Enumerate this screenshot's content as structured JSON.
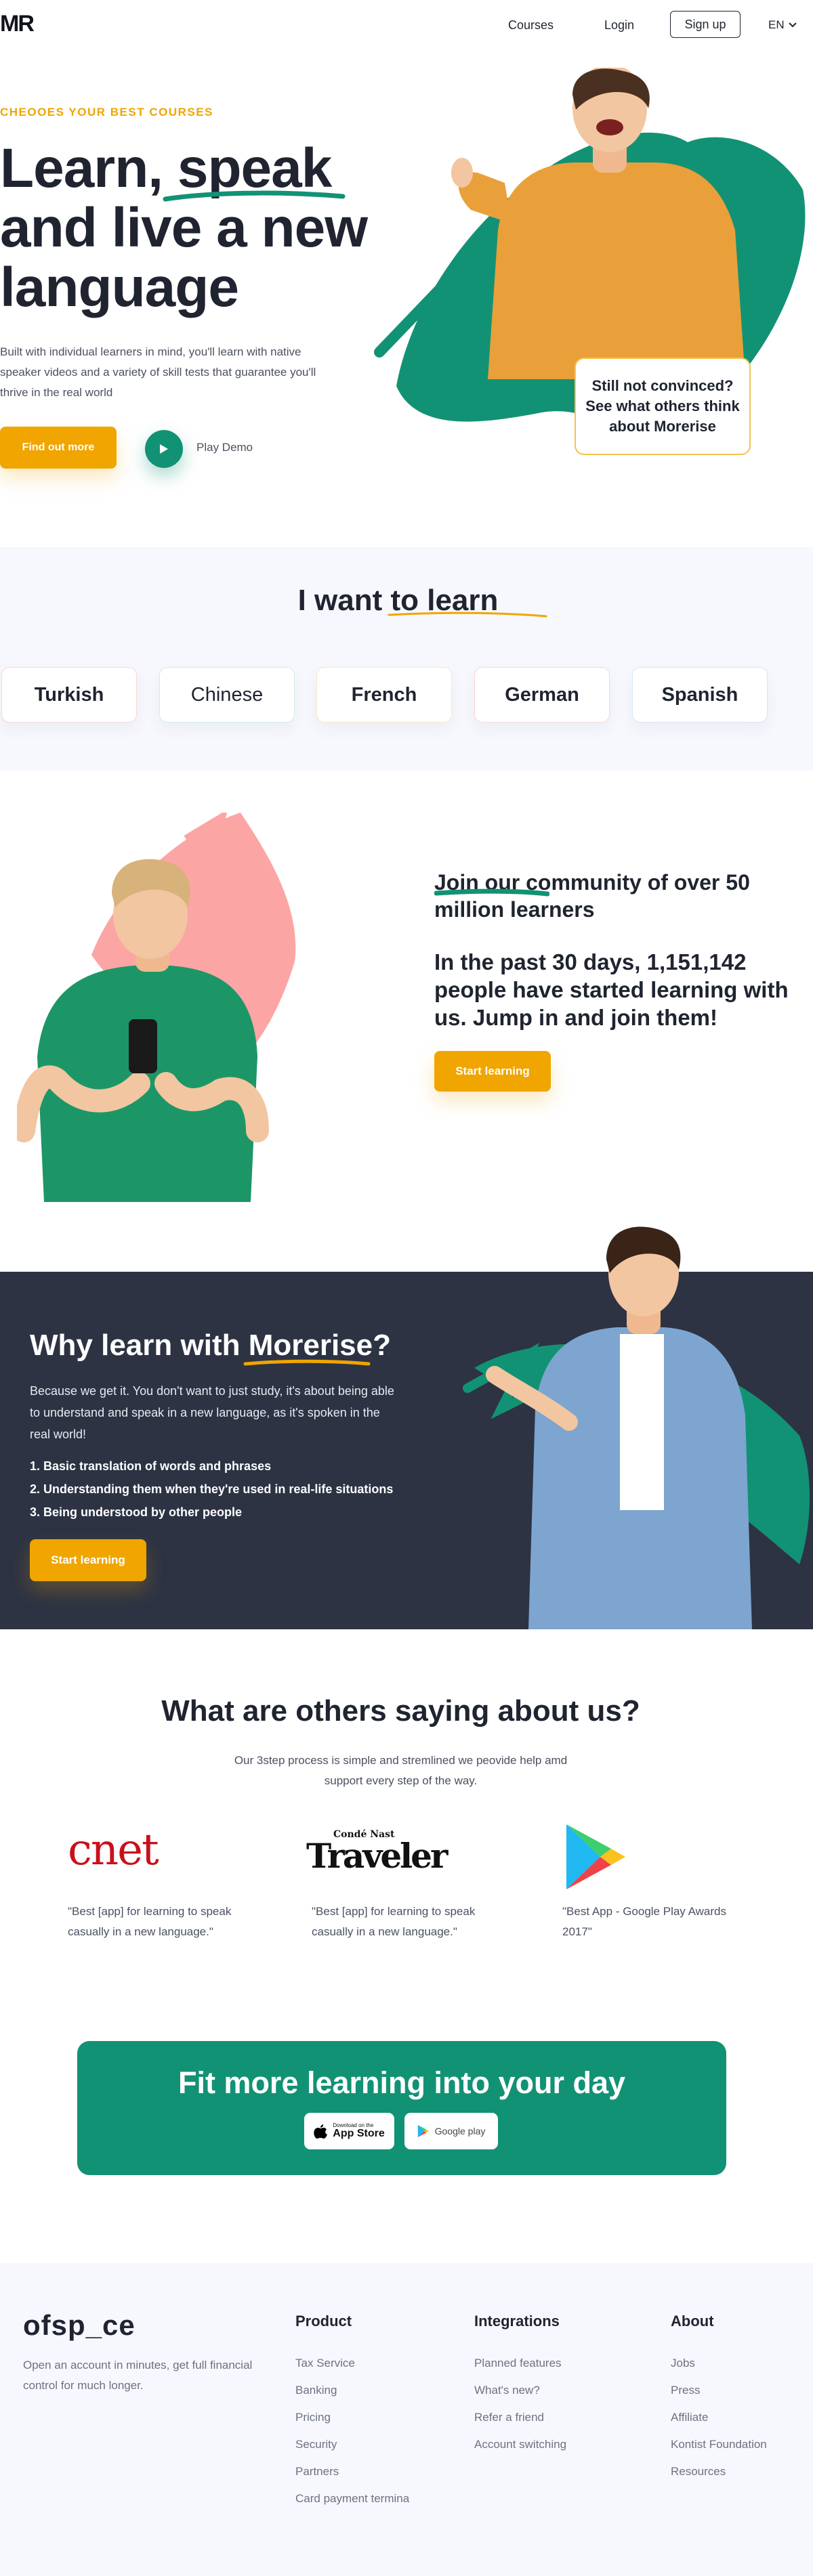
{
  "nav": {
    "logo": "MR",
    "links": [
      "Courses",
      "Login"
    ],
    "signup": "Sign up",
    "language": "EN"
  },
  "hero": {
    "eyebrow": "CHEOOES YOUR BEST COURSES",
    "title_line1": "Learn, speak",
    "title_line2": "and live a new",
    "title_line3": "language",
    "body": "Built with individual learners in mind, you'll learn with native speaker videos and a variety of skill tests that guarantee you'll thrive in the real world",
    "cta": "Find out more",
    "play_label": "Play Demo",
    "quote_card": "Still not convinced? See what others think about Morerise"
  },
  "learn": {
    "title": "I want to learn",
    "languages": [
      "Turkish",
      "Chinese",
      "French",
      "German",
      "Spanish"
    ]
  },
  "community": {
    "title": "Join our community of over 50 million learners",
    "stat": "In the past 30 days, 1,151,142 people have started learning with us. Jump in and join them!",
    "cta": "Start learning"
  },
  "why": {
    "title": "Why learn with Morerise?",
    "body": "Because we get it. You don't want to just study, it's about being able to understand and speak in a new language, as it's spoken in the real world!",
    "items": [
      "1. Basic translation of words and phrases",
      "2. Understanding them when they're used in real-life situations",
      "3. Being understood by other people"
    ],
    "cta": "Start learning"
  },
  "testimonials": {
    "title": "What are others saying about us?",
    "subtitle": "Our 3step process is simple and stremlined we peovide help amd support every step of the way.",
    "items": [
      {
        "brand": "cnet",
        "quote": "\"Best [app] for learning to speak casually in a new language.\""
      },
      {
        "brand_top": "Condé Nast",
        "brand": "Traveler",
        "quote": "\"Best [app] for learning to speak casually in a new language.\""
      },
      {
        "brand": "google-play-icon",
        "quote": "\"Best App - Google Play Awards 2017\""
      }
    ]
  },
  "band": {
    "title": "Fit more learning into your day",
    "app_store_small": "Download on the",
    "app_store": "App Store",
    "google_play": "Google play"
  },
  "footer": {
    "logo": "ofsp_ce",
    "description": "Open an account in minutes, get full financial control for much longer.",
    "columns": [
      {
        "title": "Product",
        "links": [
          "Tax Service",
          "Banking",
          "Pricing",
          "Security",
          "Partners",
          "Card payment termina"
        ]
      },
      {
        "title": "Integrations",
        "links": [
          "Planned features",
          "What's new?",
          "Refer a friend",
          "Account switching"
        ]
      },
      {
        "title": "About",
        "links": [
          "Jobs",
          "Press",
          "Affiliate",
          "Kontist Foundation",
          "Resources"
        ]
      }
    ]
  },
  "colors": {
    "accent_yellow": "#f0a500",
    "accent_green": "#129274",
    "brush_pink": "#fca5a5",
    "dark_bg": "#2d3343",
    "text_dark": "#1f2430"
  }
}
